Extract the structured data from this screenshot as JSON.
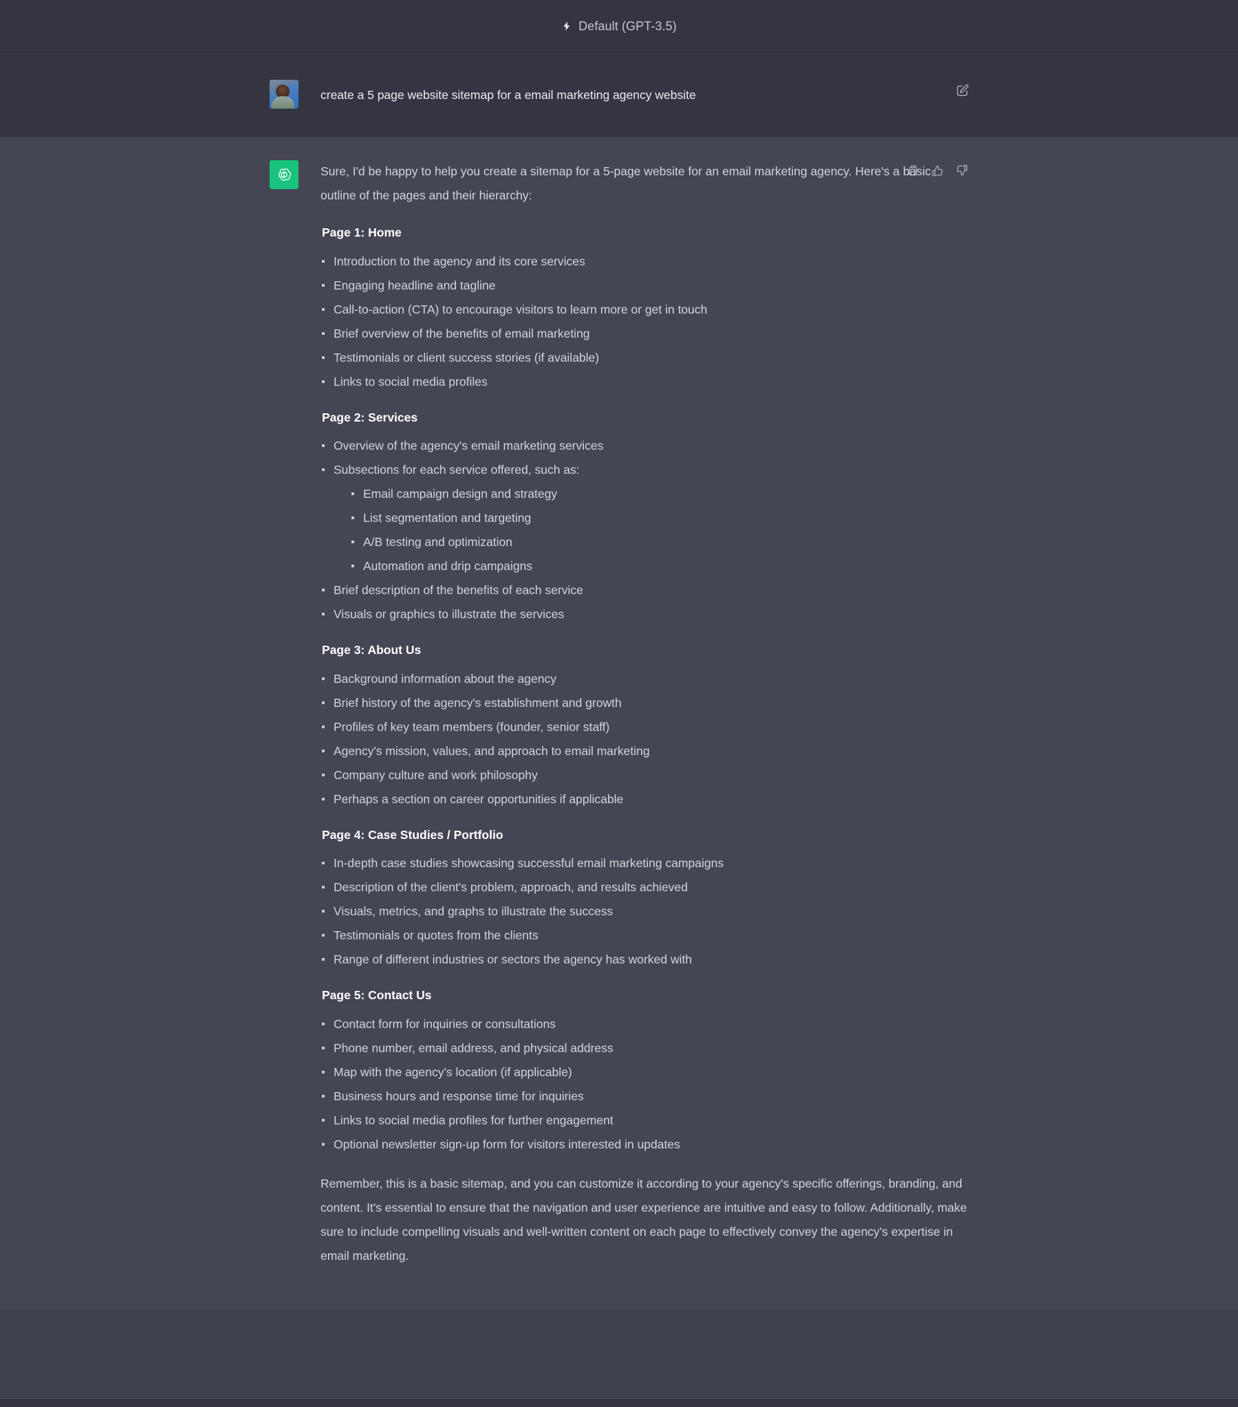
{
  "header": {
    "model_label": "Default (GPT-3.5)",
    "bolt_icon": "bolt-icon"
  },
  "user_message": {
    "avatar_icon": "user-avatar-photo",
    "text": "create a 5 page website sitemap for a email marketing agency website",
    "actions": [
      {
        "name": "edit-message-button",
        "icon": "edit-pencil-square-icon"
      }
    ]
  },
  "assistant_message": {
    "avatar_icon": "chatgpt-logo-icon",
    "intro": "Sure, I'd be happy to help you create a sitemap for a 5-page website for an email marketing agency. Here's a basic outline of the pages and their hierarchy:",
    "sections": [
      {
        "heading": "Page 1: Home",
        "items": [
          {
            "text": "Introduction to the agency and its core services"
          },
          {
            "text": "Engaging headline and tagline"
          },
          {
            "text": "Call-to-action (CTA) to encourage visitors to learn more or get in touch"
          },
          {
            "text": "Brief overview of the benefits of email marketing"
          },
          {
            "text": "Testimonials or client success stories (if available)"
          },
          {
            "text": "Links to social media profiles"
          }
        ]
      },
      {
        "heading": "Page 2: Services",
        "items": [
          {
            "text": "Overview of the agency's email marketing services"
          },
          {
            "text": "Subsections for each service offered, such as:",
            "sub_items": [
              {
                "text": "Email campaign design and strategy"
              },
              {
                "text": "List segmentation and targeting"
              },
              {
                "text": "A/B testing and optimization"
              },
              {
                "text": "Automation and drip campaigns"
              }
            ]
          },
          {
            "text": "Brief description of the benefits of each service"
          },
          {
            "text": "Visuals or graphics to illustrate the services"
          }
        ]
      },
      {
        "heading": "Page 3: About Us",
        "items": [
          {
            "text": "Background information about the agency"
          },
          {
            "text": "Brief history of the agency's establishment and growth"
          },
          {
            "text": "Profiles of key team members (founder, senior staff)"
          },
          {
            "text": "Agency's mission, values, and approach to email marketing"
          },
          {
            "text": "Company culture and work philosophy"
          },
          {
            "text": "Perhaps a section on career opportunities if applicable"
          }
        ]
      },
      {
        "heading": "Page 4: Case Studies / Portfolio",
        "items": [
          {
            "text": "In-depth case studies showcasing successful email marketing campaigns"
          },
          {
            "text": "Description of the client's problem, approach, and results achieved"
          },
          {
            "text": "Visuals, metrics, and graphs to illustrate the success"
          },
          {
            "text": "Testimonials or quotes from the clients"
          },
          {
            "text": "Range of different industries or sectors the agency has worked with"
          }
        ]
      },
      {
        "heading": "Page 5: Contact Us",
        "items": [
          {
            "text": "Contact form for inquiries or consultations"
          },
          {
            "text": "Phone number, email address, and physical address"
          },
          {
            "text": "Map with the agency's location (if applicable)"
          },
          {
            "text": "Business hours and response time for inquiries"
          },
          {
            "text": "Links to social media profiles for further engagement"
          },
          {
            "text": "Optional newsletter sign-up form for visitors interested in updates"
          }
        ]
      }
    ],
    "outro": "Remember, this is a basic sitemap, and you can customize it according to your agency's specific offerings, branding, and content. It's essential to ensure that the navigation and user experience are intuitive and easy to follow. Additionally, make sure to include compelling visuals and well-written content on each page to effectively convey the agency's expertise in email marketing.",
    "actions": [
      {
        "name": "copy-button",
        "icon": "copy-icon"
      },
      {
        "name": "thumbs-up-button",
        "icon": "thumbs-up-icon"
      },
      {
        "name": "thumbs-down-button",
        "icon": "thumbs-down-icon"
      }
    ]
  },
  "colors": {
    "user_row_bg": "#343541",
    "assistant_row_bg": "#444654",
    "page_bg": "#40414f",
    "gpt_avatar_green": "#19c37d",
    "body_text": "#d1d5db",
    "heading_text": "#ffffff",
    "muted_text": "#c5c5d2"
  }
}
